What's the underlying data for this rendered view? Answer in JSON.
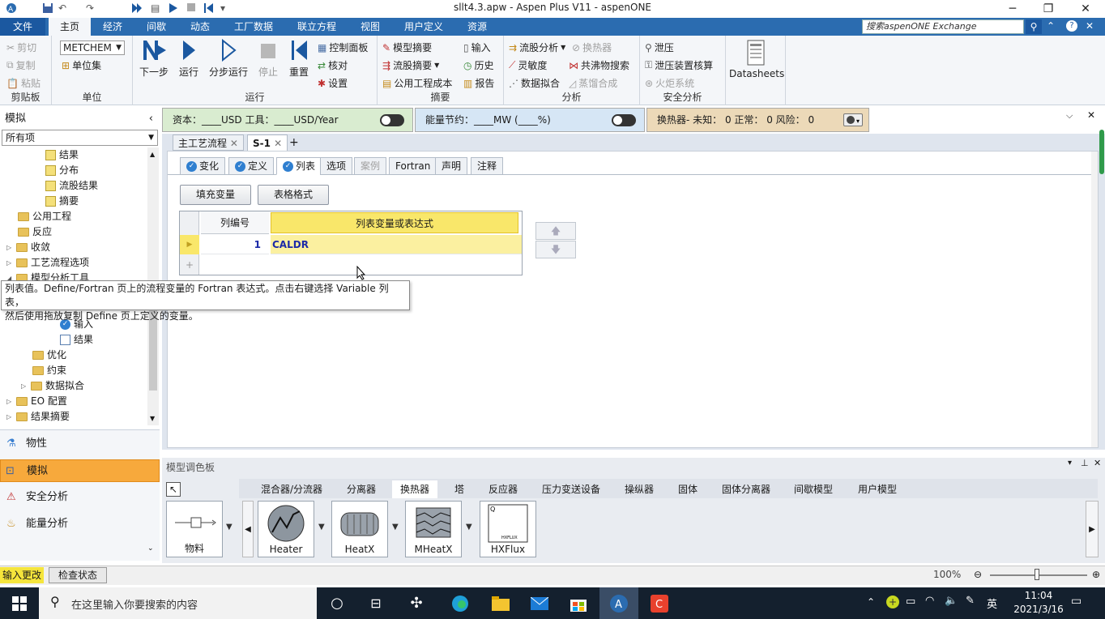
{
  "window": {
    "title": "sllt4.3.apw - Aspen Plus V11 - aspenONE",
    "minimize": "─",
    "restore": "❐",
    "close": "✕"
  },
  "ribbon_tabs": [
    "文件",
    "主页",
    "经济",
    "间歇",
    "动态",
    "工厂数据",
    "联立方程",
    "视图",
    "用户定义",
    "资源"
  ],
  "search": {
    "placeholder": "搜索aspenONE Exchange"
  },
  "ribbon": {
    "clipboard": {
      "cut": "剪切",
      "copy": "复制",
      "paste": "粘贴",
      "label": "剪贴板"
    },
    "units": {
      "unitset": "METCHEM",
      "unit_collection": "单位集",
      "label": "单位"
    },
    "run": {
      "next": "下一步",
      "run": "运行",
      "step": "分步运行",
      "stop": "停止",
      "reset": "重置",
      "control_panel": "控制面板",
      "reconcile": "核对",
      "settings": "设置",
      "label": "运行"
    },
    "summary": {
      "model_summary": "模型摘要",
      "stream_summary": "流股摘要",
      "utility_cost": "公用工程成本",
      "input": "输入",
      "history": "历史",
      "report": "报告",
      "label": "摘要"
    },
    "analysis": {
      "stream_analysis": "流股分析",
      "heat_exchanger": "换热器",
      "sensitivity": "灵敏度",
      "azeotrope": "共沸物搜索",
      "data_fit": "数据拟合",
      "distill_synth": "蒸馏合成",
      "label": "分析"
    },
    "safety": {
      "relief": "泄压",
      "relief_check": "泄压装置核算",
      "flare": "火炬系统",
      "label": "安全分析"
    },
    "datasheets": "Datasheets"
  },
  "eco_bar": {
    "capital": "资本：____USD   工具：____USD/Year",
    "energy": "能量节约：____MW    (____%)",
    "hx_status": "换热器- 未知：  0   正常：  0   风险：  0"
  },
  "nav": {
    "header": "模拟",
    "collapse": "‹",
    "filter": "所有项",
    "tree": [
      {
        "label": "结果",
        "icon": "res"
      },
      {
        "label": "分布",
        "icon": "res"
      },
      {
        "label": "流股结果",
        "icon": "res"
      },
      {
        "label": "摘要",
        "icon": "res"
      },
      {
        "label": "公用工程",
        "icon": "fold"
      },
      {
        "label": "反应",
        "icon": "fold"
      },
      {
        "label": "收敛",
        "icon": "fold"
      },
      {
        "label": "工艺流程选项",
        "icon": "fold"
      },
      {
        "label": "模型分析工具",
        "icon": "fold"
      },
      {
        "label": "输入",
        "icon": "chk"
      },
      {
        "label": "结果",
        "icon": "frm"
      },
      {
        "label": "优化",
        "icon": "fold"
      },
      {
        "label": "约束",
        "icon": "fold"
      },
      {
        "label": "数据拟合",
        "icon": "fold"
      },
      {
        "label": "EO 配置",
        "icon": "fold"
      },
      {
        "label": "结果摘要",
        "icon": "fold"
      }
    ],
    "buttons": [
      "物性",
      "模拟",
      "安全分析",
      "能量分析"
    ]
  },
  "tooltip": {
    "line1": "列表值。Define/Fortran 页上的流程变量的 Fortran 表达式。点击右键选择 Variable 列表，",
    "line2": "然后使用拖放复制 Define 页上定义的变量。"
  },
  "doc_tabs": [
    "主工艺流程",
    "S-1"
  ],
  "form_tabs": [
    "变化",
    "定义",
    "列表",
    "选项",
    "案例",
    "Fortran",
    "声明",
    "注释"
  ],
  "buttons": {
    "fill_vars": "填充变量",
    "table_format": "表格格式"
  },
  "grid": {
    "col1": "列编号",
    "col2": "列表变量或表达式",
    "rows": [
      {
        "num": "1",
        "expr": "CALDR"
      }
    ],
    "new_row": "+"
  },
  "palette": {
    "title": "模型调色板",
    "tabs": [
      "混合器/分流器",
      "分离器",
      "换热器",
      "塔",
      "反应器",
      "压力变送设备",
      "操纵器",
      "固体",
      "固体分离器",
      "间歇模型",
      "用户模型"
    ],
    "items": [
      "物料",
      "Heater",
      "HeatX",
      "MHeatX",
      "HXFlux"
    ],
    "hxflux_icon_text": "HXFLUX",
    "hxflux_corner": "Q"
  },
  "status": {
    "input_changed": "输入更改",
    "check_status": "检查状态",
    "zoom": "100%"
  },
  "taskbar": {
    "search": "在这里输入你要搜索的内容",
    "time": "11:04",
    "date": "2021/3/16",
    "ime": "英"
  },
  "colors": {
    "ribbon_blue": "#2b6cb0",
    "accent_orange": "#f7a93c",
    "eco_green": "#d9ecd0",
    "eco_blue": "#d6e6f5",
    "eco_tan": "#ecd9b8",
    "grid_yellow": "#f9e76a"
  }
}
